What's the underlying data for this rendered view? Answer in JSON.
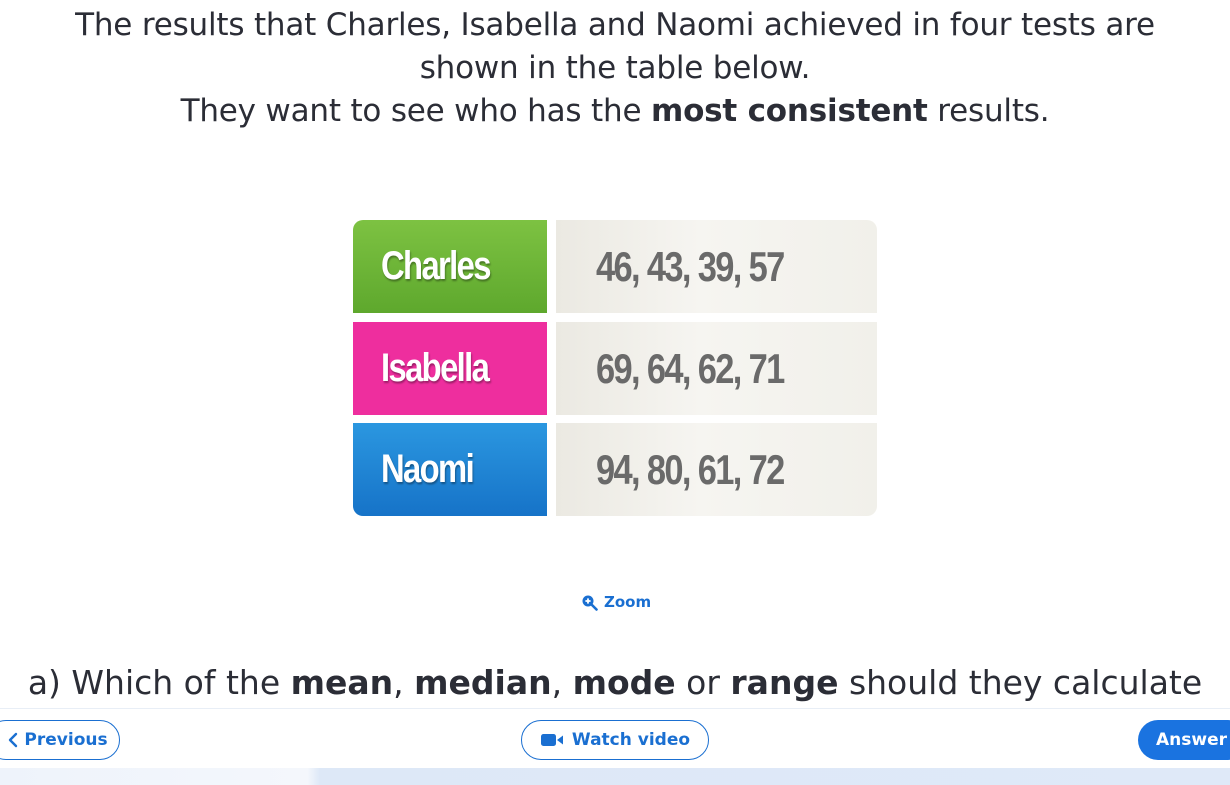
{
  "intro": {
    "line1": "The results that Charles, Isabella and Naomi achieved in four tests are",
    "line2": "shown in the table below.",
    "line3_pre": "They want to see who has the ",
    "line3_bold": "most consistent",
    "line3_post": " results."
  },
  "table": {
    "rows": [
      {
        "name": "Charles",
        "values": "46, 43, 39, 57",
        "color": "#6cb434"
      },
      {
        "name": "Isabella",
        "values": "69, 64, 62, 71",
        "color": "#ee2e9e"
      },
      {
        "name": "Naomi",
        "values": "94, 80, 61, 72",
        "color": "#1f85d6"
      }
    ]
  },
  "zoom": {
    "label": "Zoom",
    "icon": "zoom-in-icon"
  },
  "question": {
    "prefix": "a) Which of the ",
    "mean": "mean",
    "sep1": ", ",
    "median": "median",
    "sep2": ", ",
    "mode": "mode",
    "or": " or ",
    "range": "range",
    "suffix": " should they calculate"
  },
  "nav": {
    "previous_label": "Previous",
    "previous_icon": "chevron-left-icon",
    "video_label": "Watch video",
    "video_icon": "video-camera-icon",
    "answer_label": "Answer"
  },
  "colors": {
    "accent": "#1a6fd1",
    "answer_bg": "#1a73e0"
  }
}
